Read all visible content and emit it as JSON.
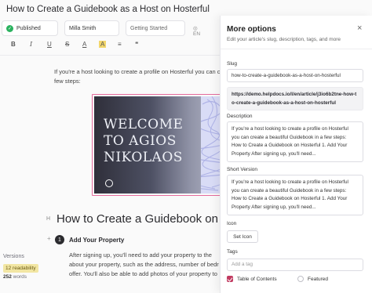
{
  "editor": {
    "title": "How to Create a Guidebook as a Host on Hosterful",
    "status": "Published",
    "author": "Milla Smith",
    "category": "Getting Started",
    "language": "EN",
    "toolbar": {
      "bold": "B",
      "italic": "I",
      "underline": "U",
      "strike": "S",
      "text_color": "A",
      "highlight": "A",
      "align": "≡",
      "quote": "❝"
    },
    "intro_lines": [
      "If you're a host looking to create a profile on Hosterful you can c",
      "few steps:"
    ],
    "cover_text": [
      "WELCOME",
      "TO AGIOS",
      "NIKOLAOS"
    ],
    "heading": "How to Create a Guidebook on H",
    "step": {
      "number": "1",
      "title": "Add Your Property"
    },
    "step_lines": [
      "After signing up, you'll need to add your property to the",
      "about your property, such as the address, number of bedr",
      "offer. You'll also be able to add photos of your property to"
    ],
    "sidebar": {
      "versions": "Versions",
      "readability": "12 readability",
      "words_count": "252",
      "words_label": "words"
    }
  },
  "panel": {
    "title": "More options",
    "subtitle": "Edit your article's slug, description, tags, and more",
    "close": "×",
    "slug_label": "Slug",
    "slug_value": "how-to-create-a-guidebook-as-a-host-on-hosterful",
    "url_lines": [
      "https://demo.helpdocs.io/l/en/article/j3io6b2tne-how-t",
      "o-create-a-guidebook-as-a-host-on-hosterful"
    ],
    "description_label": "Description",
    "description_lines": [
      "If you're a host looking to create a profile on Hosterful",
      "you can create a beautiful Guidebook in a few steps:",
      "How to Create a Guidebook on Hosterful 1. Add Your",
      "Property After signing up, you'll need..."
    ],
    "short_label": "Short Version",
    "short_lines": [
      "If you're a host looking to create a profile on Hosterful",
      "you can create a beautiful Guidebook in a few steps:",
      "How to Create a Guidebook on Hosterful 1. Add Your",
      "Property After signing up, you'll need..."
    ],
    "icon_label": "Icon",
    "set_icon": "Set Icon",
    "tags_label": "Tags",
    "tags_placeholder": "Add a tag",
    "toc_label": "Table of Contents",
    "featured_label": "Featured"
  },
  "colors": {
    "published": "#2bb25f",
    "accent": "#c13b61",
    "readability_bg": "#f2e6a3",
    "cover_border": "#e46a9c"
  }
}
